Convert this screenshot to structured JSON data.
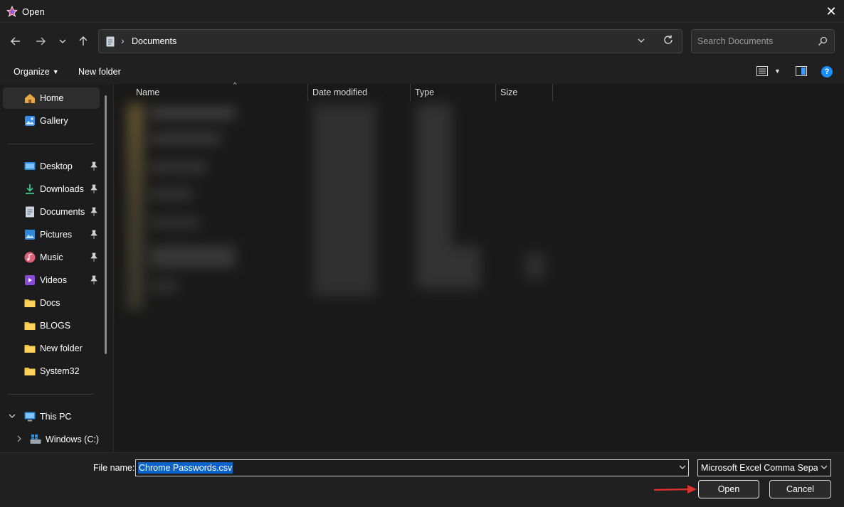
{
  "window": {
    "title": "Open",
    "close_glyph": "✕"
  },
  "nav": {
    "back_icon": "arrow-left-icon",
    "forward_icon": "arrow-right-icon",
    "recent_icon": "chevron-down-icon",
    "up_icon": "arrow-up-icon",
    "breadcrumb_separator": "›",
    "address_path": "Documents",
    "search_placeholder": "Search Documents"
  },
  "toolbar": {
    "organize_label": "Organize",
    "new_folder_label": "New folder",
    "help_glyph": "?"
  },
  "sidebar": {
    "quick": [
      {
        "label": "Home",
        "icon": "home-icon",
        "selected": true
      },
      {
        "label": "Gallery",
        "icon": "gallery-icon"
      }
    ],
    "pinned": [
      {
        "label": "Desktop",
        "icon": "desktop-icon",
        "pinned": true
      },
      {
        "label": "Downloads",
        "icon": "download-icon",
        "pinned": true
      },
      {
        "label": "Documents",
        "icon": "document-icon",
        "pinned": true
      },
      {
        "label": "Pictures",
        "icon": "pictures-icon",
        "pinned": true
      },
      {
        "label": "Music",
        "icon": "music-icon",
        "pinned": true
      },
      {
        "label": "Videos",
        "icon": "videos-icon",
        "pinned": true
      },
      {
        "label": "Docs",
        "icon": "folder-icon"
      },
      {
        "label": "BLOGS",
        "icon": "folder-icon"
      },
      {
        "label": "New folder",
        "icon": "folder-icon"
      },
      {
        "label": "System32",
        "icon": "folder-icon"
      }
    ],
    "this_pc": {
      "label": "This PC",
      "icon": "computer-icon",
      "expanded": true
    },
    "drive": {
      "label": "Windows (C:)",
      "icon": "drive-icon"
    }
  },
  "file_list": {
    "columns": [
      "Name",
      "Date modified",
      "Type",
      "Size"
    ],
    "sorted_column": "Name",
    "sort_glyph": "^",
    "rows_blurred": true
  },
  "footer": {
    "file_name_label": "File name:",
    "file_name_value": "Chrome Passwords.csv",
    "file_type_value": "Microsoft Excel Comma Separated Values File",
    "open_label": "Open",
    "cancel_label": "Cancel"
  },
  "colors": {
    "accent": "#0a63c6",
    "help": "#1a8fff",
    "annotation_arrow": "#e03030",
    "folder": "#f0c040"
  }
}
